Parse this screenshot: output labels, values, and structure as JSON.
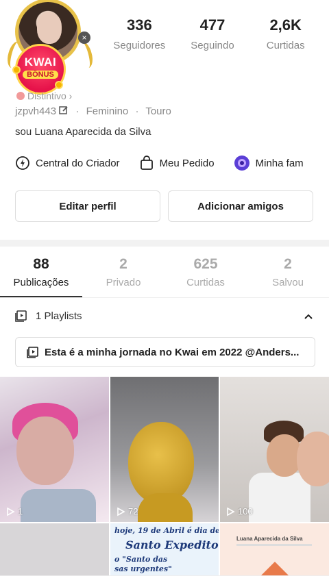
{
  "profile": {
    "badge_top": "KWAI",
    "badge_bottom": "BÔNUS",
    "distintivo": "Distintivo ›",
    "username": "jzpvh443",
    "gender": "Feminino",
    "sign": "Touro",
    "bio": "sou Luana Aparecida da Silva"
  },
  "stats": [
    {
      "value": "336",
      "label": "Seguidores"
    },
    {
      "value": "477",
      "label": "Seguindo"
    },
    {
      "value": "2,6K",
      "label": "Curtidas"
    }
  ],
  "shortcuts": [
    {
      "label": "Central do Criador",
      "icon": "lightning-icon"
    },
    {
      "label": "Meu Pedido",
      "icon": "bag-icon"
    },
    {
      "label": "Minha fam",
      "icon": "family-icon"
    }
  ],
  "actions": {
    "edit": "Editar perfil",
    "add_friends": "Adicionar amigos"
  },
  "tabs": [
    {
      "value": "88",
      "label": "Publicações"
    },
    {
      "value": "2",
      "label": "Privado"
    },
    {
      "value": "625",
      "label": "Curtidas"
    },
    {
      "value": "2",
      "label": "Salvou"
    }
  ],
  "playlists": {
    "header": "1 Playlists",
    "item": "Esta é a minha jornada no Kwai em 2022 @Anders..."
  },
  "videos": [
    {
      "plays": "1"
    },
    {
      "plays": "72"
    },
    {
      "plays": "100"
    }
  ],
  "thumb5": {
    "line1": "hoje, 19 de Abril é dia de",
    "line2": "Santo Expedito.",
    "line3": "o \"Santo das",
    "line4": "sas urgentes\""
  },
  "thumb6": {
    "author": "Luana Aparecida da Silva"
  }
}
